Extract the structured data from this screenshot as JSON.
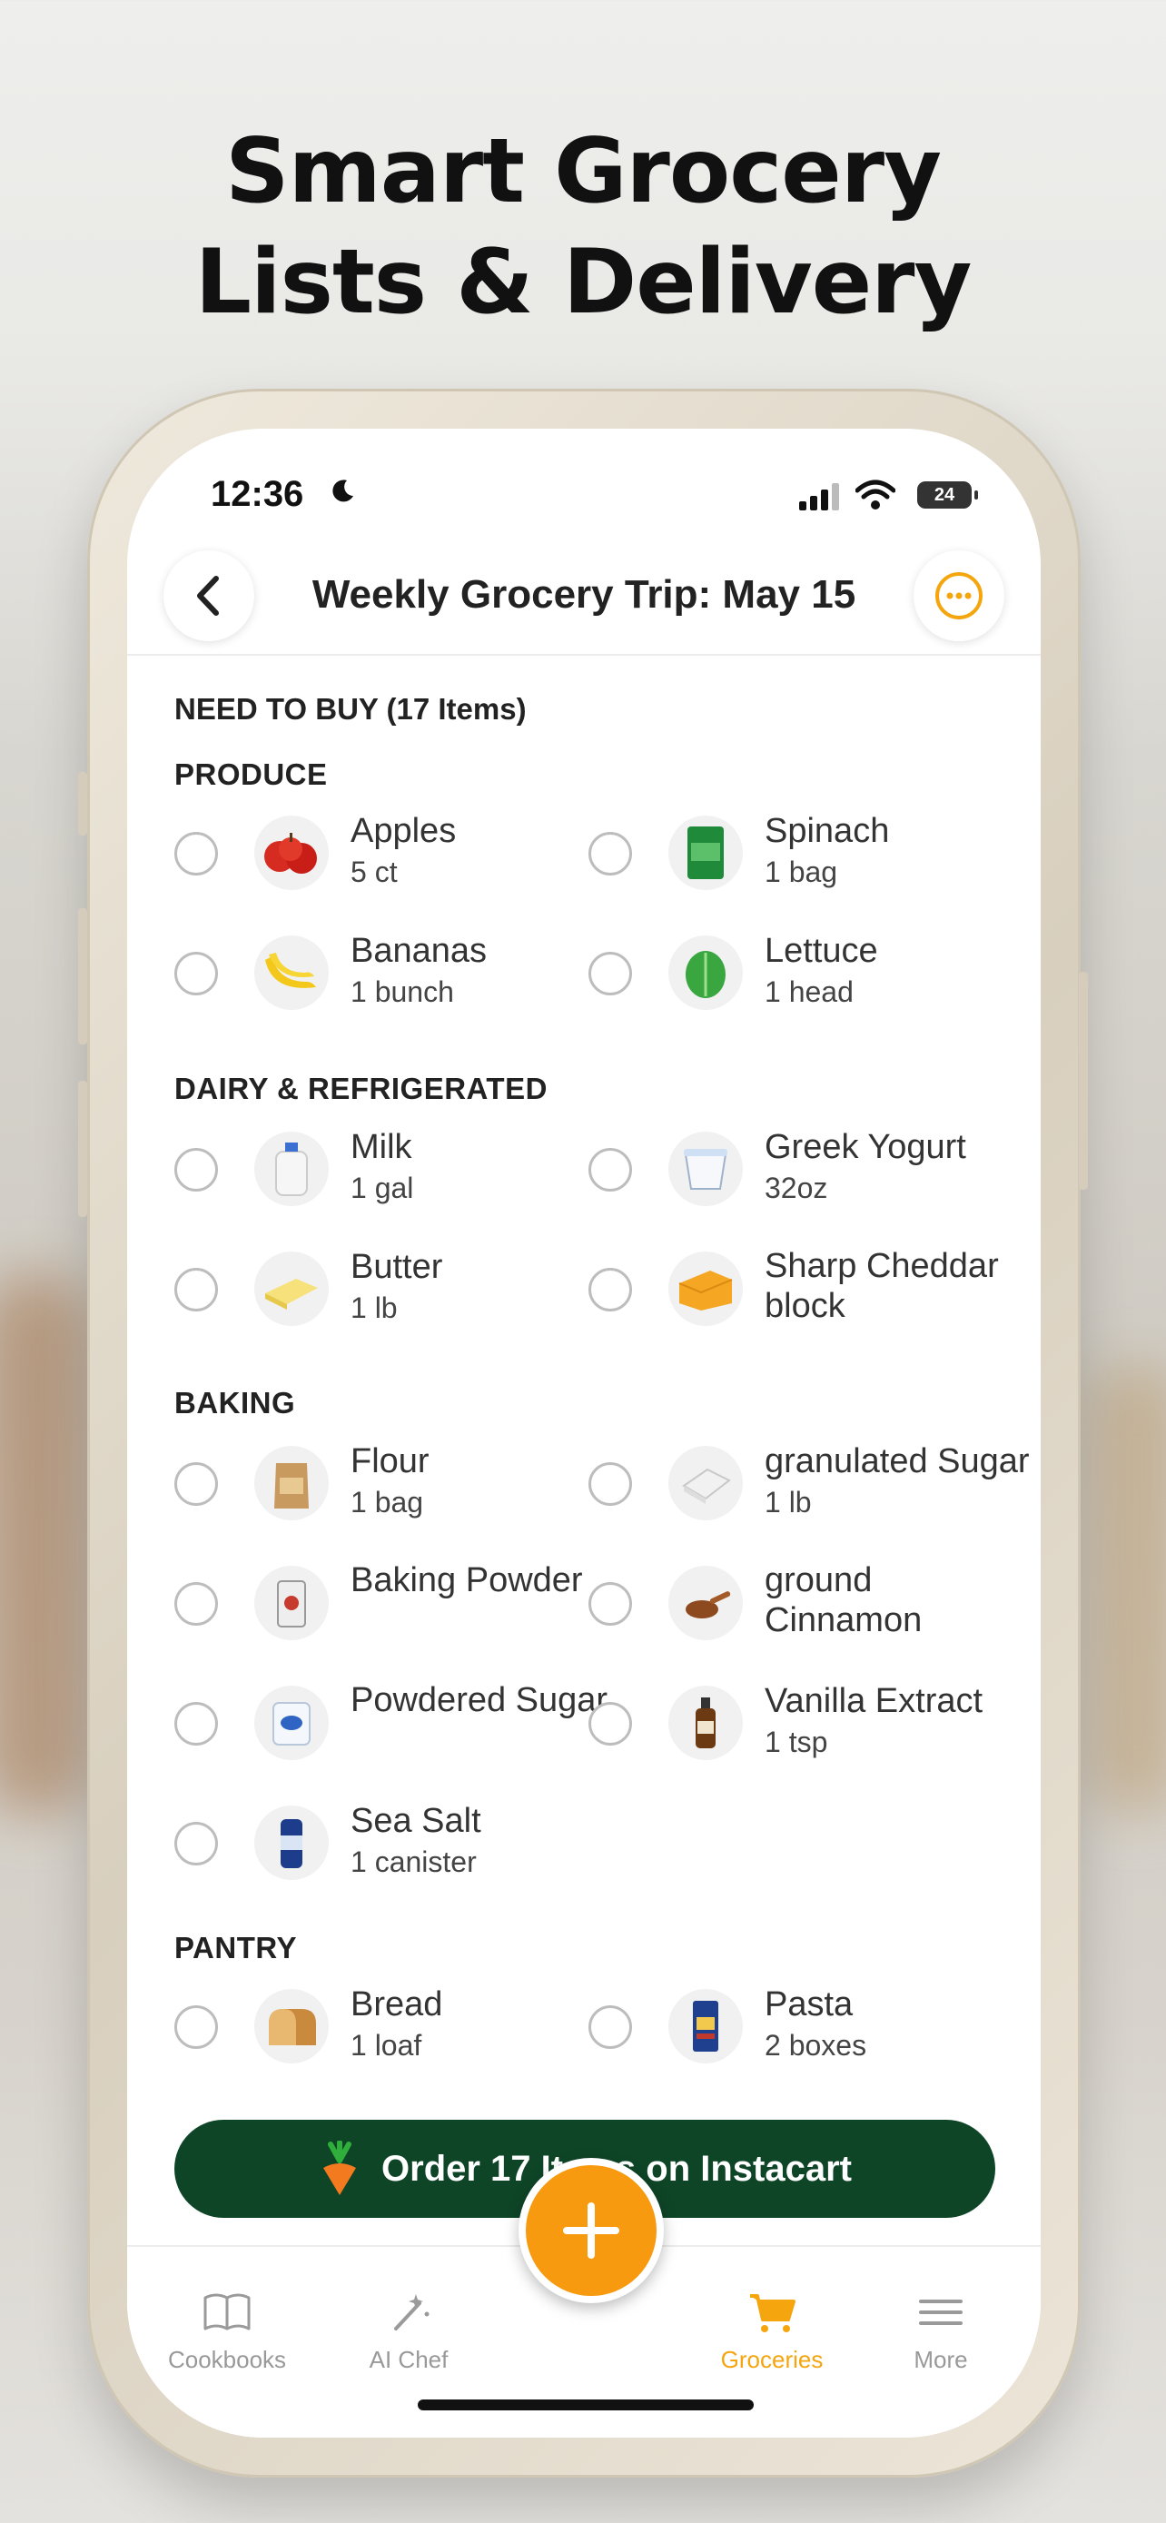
{
  "headline": {
    "line1": "Smart Grocery",
    "line2": "Lists & Delivery"
  },
  "status_bar": {
    "time": "12:36",
    "battery": "24"
  },
  "header": {
    "title": "Weekly Grocery Trip: May 15"
  },
  "list": {
    "heading": "NEED TO BUY (17 Items)",
    "sections": [
      {
        "title": "PRODUCE",
        "items": [
          {
            "name": "Apples",
            "qty": "5 ct",
            "icon": "apples-icon"
          },
          {
            "name": "Spinach",
            "qty": "1 bag",
            "icon": "spinach-icon"
          },
          {
            "name": "Bananas",
            "qty": "1 bunch",
            "icon": "bananas-icon"
          },
          {
            "name": "Lettuce",
            "qty": "1 head",
            "icon": "lettuce-icon"
          }
        ]
      },
      {
        "title": "DAIRY & REFRIGERATED",
        "items": [
          {
            "name": "Milk",
            "qty": "1 gal",
            "icon": "milk-icon"
          },
          {
            "name": "Greek Yogurt",
            "qty": "32oz",
            "icon": "yogurt-icon"
          },
          {
            "name": "Butter",
            "qty": "1 lb",
            "icon": "butter-icon"
          },
          {
            "name": "Sharp Cheddar block",
            "qty": "",
            "icon": "cheese-icon"
          }
        ]
      },
      {
        "title": "BAKING",
        "items": [
          {
            "name": "Flour",
            "qty": "1 bag",
            "icon": "flour-icon"
          },
          {
            "name": "granulated Sugar",
            "qty": "1 lb",
            "icon": "sugar-icon"
          },
          {
            "name": "Baking Powder",
            "qty": "",
            "icon": "baking-powder-icon"
          },
          {
            "name": "ground Cinnamon",
            "qty": "",
            "icon": "cinnamon-icon"
          },
          {
            "name": "Powdered Sugar",
            "qty": "",
            "icon": "powdered-sugar-icon"
          },
          {
            "name": "Vanilla Extract",
            "qty": "1 tsp",
            "icon": "vanilla-icon"
          },
          {
            "name": "Sea Salt",
            "qty": "1 canister",
            "icon": "salt-icon"
          }
        ]
      },
      {
        "title": "PANTRY",
        "items": [
          {
            "name": "Bread",
            "qty": "1 loaf",
            "icon": "bread-icon"
          },
          {
            "name": "Pasta",
            "qty": "2 boxes",
            "icon": "pasta-icon"
          }
        ]
      }
    ]
  },
  "order_button": {
    "label": "Order 17 Items on Instacart"
  },
  "tabs": [
    {
      "label": "Cookbooks",
      "icon": "book-icon",
      "active": false
    },
    {
      "label": "AI Chef",
      "icon": "magic-wand-icon",
      "active": false
    },
    {
      "label": "Groceries",
      "icon": "cart-icon",
      "active": true
    },
    {
      "label": "More",
      "icon": "menu-icon",
      "active": false
    }
  ],
  "colors": {
    "accent": "#f79a10",
    "order_green": "#0e4527",
    "active_tab": "#f5a50d"
  }
}
